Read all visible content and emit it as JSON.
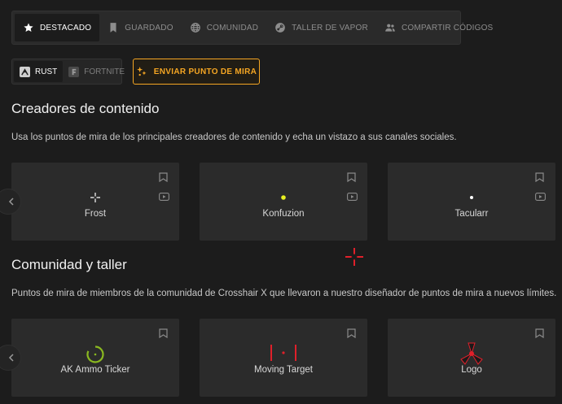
{
  "tabs": [
    {
      "label": "DESTACADO",
      "icon": "star-icon",
      "active": true
    },
    {
      "label": "GUARDADO",
      "icon": "bookmark-icon",
      "active": false
    },
    {
      "label": "COMUNIDAD",
      "icon": "globe-icon",
      "active": false
    },
    {
      "label": "TALLER DE VAPOR",
      "icon": "steam-icon",
      "active": false
    },
    {
      "label": "COMPARTIR CÓDIGOS",
      "icon": "users-icon",
      "active": false
    }
  ],
  "games": [
    {
      "label": "RUST",
      "icon": "rust-logo-icon",
      "active": true
    },
    {
      "label": "FORTNITE",
      "icon": "fortnite-logo-icon",
      "active": false
    }
  ],
  "submit_button": {
    "label": "ENVIAR PUNTO DE MIRA",
    "icon": "crosshair-sparkle-icon"
  },
  "creators": {
    "title": "Creadores de contenido",
    "description": "Usa los puntos de mira de los principales creadores de contenido y echa un vistazo a sus canales sociales.",
    "cards": [
      {
        "name": "Frost"
      },
      {
        "name": "Konfuzion"
      },
      {
        "name": "Tacularr"
      }
    ]
  },
  "community": {
    "title": "Comunidad y taller",
    "description": "Puntos de mira de miembros de la comunidad de Crosshair X que llevaron a nuestro diseñador de puntos de mira a nuevos límites.",
    "cards": [
      {
        "name": "AK Ammo Ticker"
      },
      {
        "name": "Moving Target"
      },
      {
        "name": "Logo"
      }
    ]
  },
  "colors": {
    "accent": "#f5a623",
    "background": "#1c1c1c",
    "card": "#2b2b2b",
    "crosshair_red": "#e0202a",
    "crosshair_yellow": "#e8f020",
    "crosshair_green": "#8ab820"
  }
}
